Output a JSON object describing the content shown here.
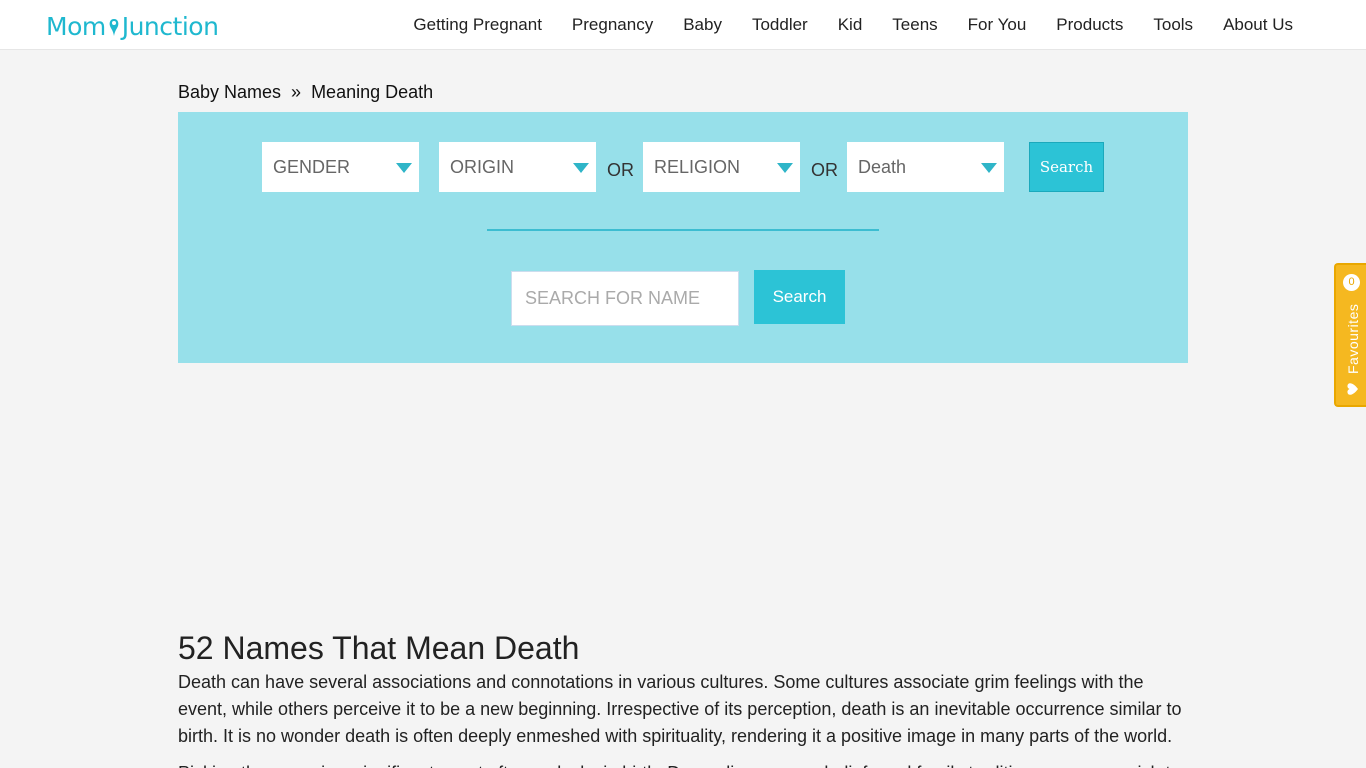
{
  "header": {
    "logo_left": "Mom",
    "logo_right": "Junction",
    "nav": [
      "Getting Pregnant",
      "Pregnancy",
      "Baby",
      "Toddler",
      "Kid",
      "Teens",
      "For You",
      "Products",
      "Tools",
      "About Us"
    ]
  },
  "breadcrumb": {
    "root": "Baby Names",
    "separator": "»",
    "current": "Meaning Death"
  },
  "filters": {
    "gender": "GENDER",
    "origin": "ORIGIN",
    "or1": "OR",
    "religion": "RELIGION",
    "or2": "OR",
    "meaning": "Death",
    "search_label": "Search"
  },
  "name_search": {
    "placeholder": "SEARCH FOR NAME",
    "button": "Search"
  },
  "article": {
    "title": "52 Names That Mean Death",
    "paragraph1": "Death can have several associations and connotations in various cultures. Some cultures associate grim feelings with the event, while others perceive it to be a new beginning. Irrespective of its perception, death is an inevitable occurrence similar to birth. It is no wonder death is often deeply enmeshed with spirituality, rendering it a positive image in many parts of the world.",
    "paragraph2": "Picking the name is a significant event often as lucky in birth. Depending on your beliefs and family traditions, you may wish to"
  },
  "favourites": {
    "count": "0",
    "label": "Favourites"
  },
  "colors": {
    "brand": "#1fb8cf",
    "panel": "#97e0ea",
    "button": "#2cc3d6",
    "favourites": "#f5b820"
  }
}
